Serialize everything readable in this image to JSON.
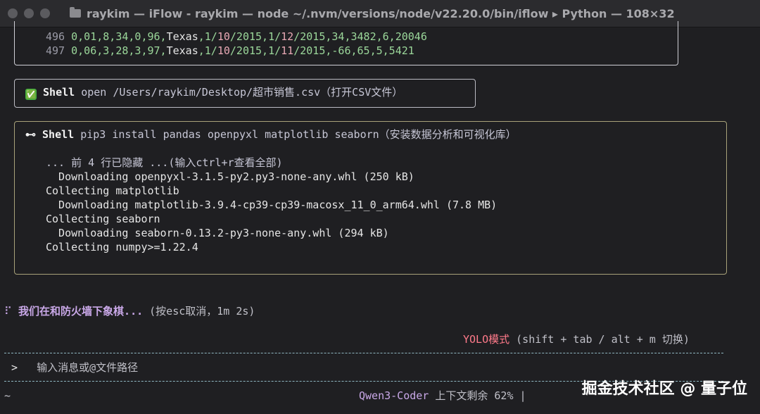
{
  "window": {
    "title": "raykim — iFlow - raykim — node ~/.nvm/versions/node/v22.20.0/bin/iflow ▸ Python — 108×32"
  },
  "csv_rows": [
    {
      "num": "496",
      "a": "0,01,8,34,0,96,",
      "state": "Texas",
      "d1a": ",1/",
      "d1b": "10",
      "d1c": "/2015,",
      "d2a": "1/",
      "d2b": "12",
      "d2c": "/2015,",
      "tail": "34,3482,6,20046"
    },
    {
      "num": "497",
      "a": "0,06,3,28,3,97,",
      "state": "Texas",
      "d1a": ",1/",
      "d1b": "10",
      "d1c": "/2015,",
      "d2a": "1/",
      "d2b": "11",
      "d2c": "/2015,",
      "tail": "-66,65,5,5421"
    }
  ],
  "shell_open": {
    "status": "✅",
    "label": "Shell",
    "command": "open /Users/raykim/Desktop/超市销售.csv（打开CSV文件）"
  },
  "shell_pip": {
    "status": "⊷",
    "label": "Shell",
    "command": "pip3 install pandas openpyxl matplotlib seaborn（安装数据分析和可视化库）",
    "hidden_note": "... 前 4 行已隐藏 ...(输入ctrl+r查看全部)",
    "output": [
      "  Downloading openpyxl-3.1.5-py2.py3-none-any.whl (250 kB)",
      "Collecting matplotlib",
      "  Downloading matplotlib-3.9.4-cp39-cp39-macosx_11_0_arm64.whl (7.8 MB)",
      "Collecting seaborn",
      "  Downloading seaborn-0.13.2-py3-none-any.whl (294 kB)",
      "Collecting numpy>=1.22.4"
    ]
  },
  "thinking": {
    "spinner": "⠏",
    "text": "我们在和防火墙下象棋...",
    "hint": "(按esc取消，1m 2s)"
  },
  "mode": {
    "label": "YOLO模式",
    "hint": "(shift + tab / alt + m 切换)"
  },
  "input": {
    "prompt": ">",
    "placeholder": "输入消息或@文件路径"
  },
  "footer": {
    "cwd": "~",
    "model": "Qwen3-Coder",
    "context": "上下文剩余 62%",
    "sep": "|"
  },
  "watermark": "掘金技术社区 @ 量子位",
  "colors": {
    "background": "#1f1f22",
    "accent_green": "#9bd79a",
    "accent_pink": "#ff7a8a",
    "accent_purple": "#c9a8e8"
  }
}
